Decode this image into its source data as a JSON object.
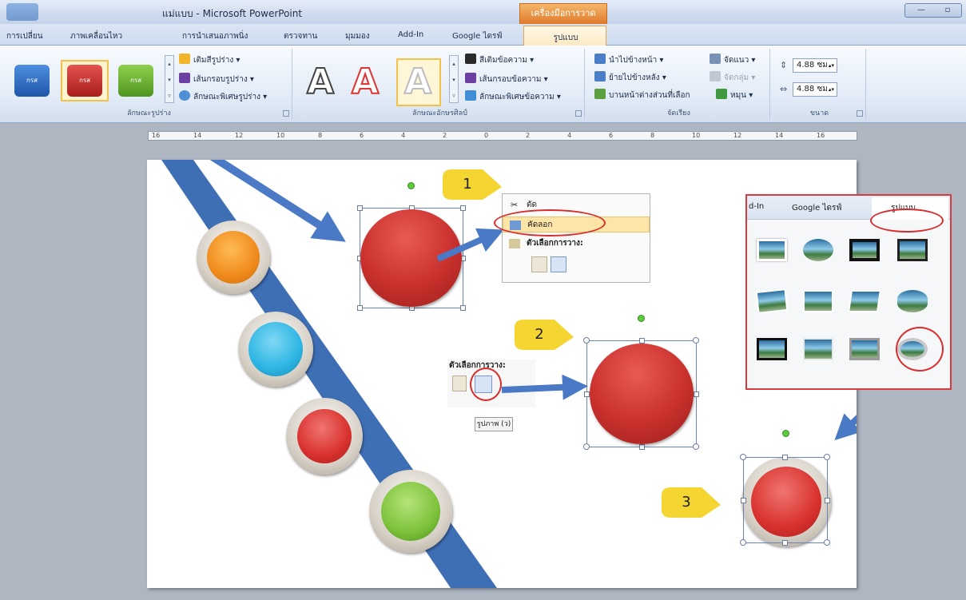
{
  "window": {
    "title": "แม่แบบ - Microsoft PowerPoint",
    "context_tab_header": "เครื่องมือการวาด",
    "minimize": "—",
    "maximize": "▫"
  },
  "tabs": [
    {
      "label": "การเปลี่ยน"
    },
    {
      "label": "ภาพเคลื่อนไหว"
    },
    {
      "label": "การนำเสนอภาพนิ่ง"
    },
    {
      "label": "ตรวจทาน"
    },
    {
      "label": "มุมมอง"
    },
    {
      "label": "Add-In"
    },
    {
      "label": "Google ไดรฟ์"
    },
    {
      "label": "รูปแบบ"
    }
  ],
  "ribbon": {
    "shape_styles": {
      "label": "ลักษณะรูปร่าง",
      "swatches": [
        {
          "color": "#2d6fc7",
          "text": "กรส"
        },
        {
          "color": "#c8302c",
          "text": "กรส"
        },
        {
          "color": "#67b12f",
          "text": "กรส"
        }
      ],
      "fill": "เติมสีรูปร่าง ▾",
      "outline": "เส้นกรอบรูปร่าง ▾",
      "effects": "ลักษณะพิเศษรูปร่าง ▾"
    },
    "wordart": {
      "label": "ลักษณะอักษรศิลป์",
      "text_fill": "สีเติมข้อความ ▾",
      "text_outline": "เส้นกรอบข้อความ ▾",
      "text_effects": "ลักษณะพิเศษข้อความ ▾"
    },
    "arrange": {
      "label": "จัดเรียง",
      "bring_forward": "นำไปข้างหน้า ▾",
      "send_backward": "ย้ายไปข้างหลัง ▾",
      "selection_pane": "บานหน้าต่างส่วนที่เลือก",
      "align": "จัดแนว ▾",
      "group": "จัดกลุ่ม ▾",
      "rotate": "หมุน ▾"
    },
    "size": {
      "label": "ขนาด",
      "height": "4.88 ซม.",
      "width": "4.88 ซม."
    }
  },
  "ruler": {
    "ticks": [
      "16",
      "14",
      "12",
      "10",
      "8",
      "6",
      "4",
      "2",
      "0",
      "2",
      "4",
      "6",
      "8",
      "10",
      "12",
      "14",
      "16"
    ]
  },
  "slide": {
    "callouts": [
      "1",
      "2",
      "3"
    ],
    "context_menu": {
      "cut": "ตัด",
      "copy": "คัดลอก",
      "paste_options": "ตัวเลือกการวาง:"
    },
    "paste_options_2": "ตัวเลือกการวาง:",
    "tooltip": "รูปภาพ (ว)",
    "picture_panel": {
      "tab_addin": "d-In",
      "tab_google": "Google ไดรฟ์",
      "tab_format": "รูปแบบ"
    },
    "colors": {
      "orange": "#f08a1c",
      "cyan": "#2cb5e3",
      "red": "#d8312e",
      "green": "#7cc23a",
      "ribbon_blue": "#3e6fb5",
      "arrow_blue": "#4a79c6",
      "callout_yellow": "#f5d531",
      "highlight_red": "#d92c2c"
    }
  }
}
